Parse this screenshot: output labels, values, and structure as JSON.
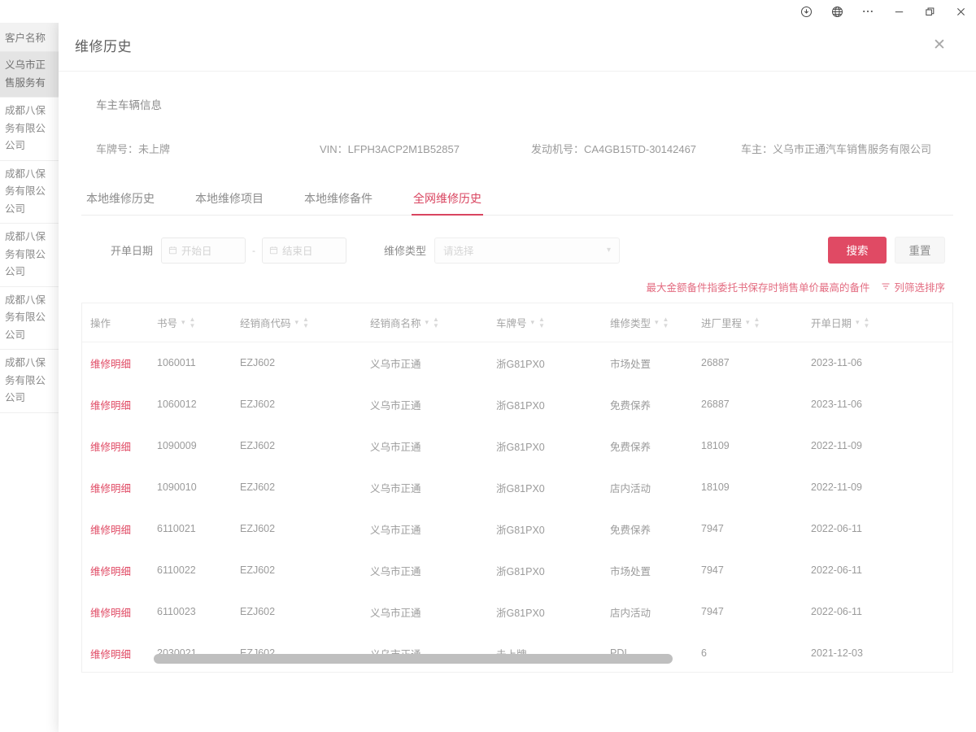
{
  "window_controls": [
    {
      "name": "download-icon",
      "label": "↓"
    },
    {
      "name": "globe-icon",
      "label": "🌐"
    },
    {
      "name": "more-icon",
      "label": "…"
    },
    {
      "name": "minimize-icon",
      "label": "—"
    },
    {
      "name": "restore-icon",
      "label": "❐"
    },
    {
      "name": "close-icon",
      "label": "✕"
    }
  ],
  "background": {
    "column_header": "客户名称",
    "rows": [
      "义乌市正\n售服务有",
      "成都八保\n务有限公\n公司",
      "成都八保\n务有限公\n公司",
      "成都八保\n务有限公\n公司",
      "成都八保\n务有限公\n公司",
      "成都八保\n务有限公\n公司"
    ]
  },
  "modal": {
    "title": "维修历史",
    "close_label": "✕"
  },
  "vehicle": {
    "section_title": "车主车辆信息",
    "plate": "车牌号：未上牌",
    "vin": "VIN：LFPH3ACP2M1B52857",
    "engine": "发动机号：CA4GB15TD-30142467",
    "owner": "车主：义乌市正通汽车销售服务有限公司"
  },
  "tabs": [
    {
      "label": "本地维修历史",
      "active": false
    },
    {
      "label": "本地维修项目",
      "active": false
    },
    {
      "label": "本地维修备件",
      "active": false
    },
    {
      "label": "全网维修历史",
      "active": true
    }
  ],
  "filters": {
    "date_label": "开单日期",
    "date_start_placeholder": "开始日",
    "date_end_placeholder": "结束日",
    "date_separator": "-",
    "type_label": "维修类型",
    "type_placeholder": "请选择",
    "search_label": "搜索",
    "reset_label": "重置"
  },
  "note": {
    "text": "最大金额备件指委托书保存时销售单价最高的备件",
    "tool_label": "列筛选排序"
  },
  "table": {
    "columns": [
      {
        "key": "action",
        "label": "操作",
        "sortable": false
      },
      {
        "key": "book_no",
        "label": "书号",
        "sortable": true
      },
      {
        "key": "dealer_code",
        "label": "经销商代码",
        "sortable": true
      },
      {
        "key": "dealer_name",
        "label": "经销商名称",
        "sortable": true
      },
      {
        "key": "plate",
        "label": "车牌号",
        "sortable": true
      },
      {
        "key": "repair_type",
        "label": "维修类型",
        "sortable": true
      },
      {
        "key": "mileage",
        "label": "进厂里程",
        "sortable": true
      },
      {
        "key": "bill_date",
        "label": "开单日期",
        "sortable": true
      }
    ],
    "action_label": "维修明细",
    "rows": [
      {
        "book_no": "1060011",
        "dealer_code": "EZJ602",
        "dealer_name": "义乌市正通",
        "plate": "浙G81PX0",
        "repair_type": "市场处置",
        "mileage": "26887",
        "bill_date": "2023-11-06"
      },
      {
        "book_no": "1060012",
        "dealer_code": "EZJ602",
        "dealer_name": "义乌市正通",
        "plate": "浙G81PX0",
        "repair_type": "免费保养",
        "mileage": "26887",
        "bill_date": "2023-11-06"
      },
      {
        "book_no": "1090009",
        "dealer_code": "EZJ602",
        "dealer_name": "义乌市正通",
        "plate": "浙G81PX0",
        "repair_type": "免费保养",
        "mileage": "18109",
        "bill_date": "2022-11-09"
      },
      {
        "book_no": "1090010",
        "dealer_code": "EZJ602",
        "dealer_name": "义乌市正通",
        "plate": "浙G81PX0",
        "repair_type": "店内活动",
        "mileage": "18109",
        "bill_date": "2022-11-09"
      },
      {
        "book_no": "6110021",
        "dealer_code": "EZJ602",
        "dealer_name": "义乌市正通",
        "plate": "浙G81PX0",
        "repair_type": "免费保养",
        "mileage": "7947",
        "bill_date": "2022-06-11"
      },
      {
        "book_no": "6110022",
        "dealer_code": "EZJ602",
        "dealer_name": "义乌市正通",
        "plate": "浙G81PX0",
        "repair_type": "市场处置",
        "mileage": "7947",
        "bill_date": "2022-06-11"
      },
      {
        "book_no": "6110023",
        "dealer_code": "EZJ602",
        "dealer_name": "义乌市正通",
        "plate": "浙G81PX0",
        "repair_type": "店内活动",
        "mileage": "7947",
        "bill_date": "2022-06-11"
      },
      {
        "book_no": "2030021",
        "dealer_code": "EZJ602",
        "dealer_name": "义乌市正通",
        "plate": "未上牌",
        "repair_type": "PDI",
        "mileage": "6",
        "bill_date": "2021-12-03"
      }
    ]
  },
  "colors": {
    "accent": "#e04a64",
    "accent_soft": "#e36b80",
    "text_muted": "#9b9b9b"
  }
}
